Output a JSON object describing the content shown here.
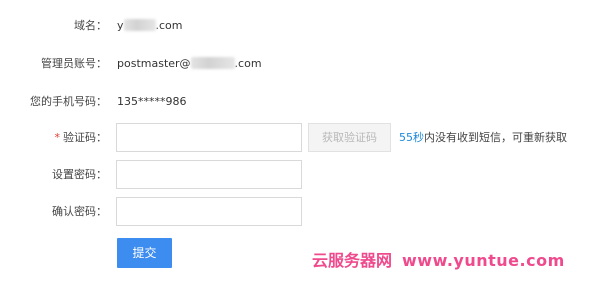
{
  "form": {
    "domain": {
      "label": "域名：",
      "suffix": ".com"
    },
    "admin_account": {
      "label": "管理员账号：",
      "prefix": "postmaster@",
      "suffix": ".com"
    },
    "phone": {
      "label": "您的手机号码：",
      "value": "135*****986"
    },
    "verify_code": {
      "required_mark": "*",
      "label": "验证码：",
      "get_code_button": "获取验证码",
      "countdown_seconds": "55秒",
      "countdown_text": "内没有收到短信，可重新获取"
    },
    "set_password": {
      "label": "设置密码："
    },
    "confirm_password": {
      "label": "确认密码："
    },
    "submit_button": "提交"
  },
  "watermark": {
    "brand": "云服务器网",
    "url": "www.yuntue.com"
  },
  "colors": {
    "accent_blue": "#3d8cf0",
    "link_blue": "#1c8ad9",
    "required_red": "#e03c31",
    "watermark_pink": "#ef4a8d"
  }
}
